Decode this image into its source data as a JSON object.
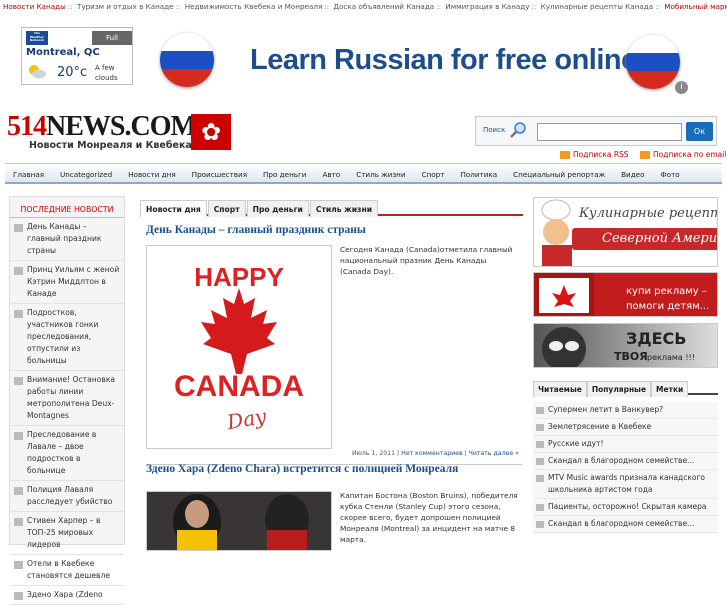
{
  "topnav": {
    "items": [
      "Новости Канады",
      "Туризм и отдых в Канаде",
      "Недвижимость Квебека и Монреаля",
      "Доска объявлений Канада",
      "Иммиграция в Канаду",
      "Кулинарные рецепты Канада",
      "Мобильный маркетинг"
    ],
    "separator": "::"
  },
  "weather": {
    "logo": "The Weather Network",
    "full_forecast": "Full Forecast",
    "city": "Montreal, QC",
    "temp": "20°c",
    "condition": "A few clouds"
  },
  "banner": {
    "text": "Learn Russian for free online!"
  },
  "logo": {
    "main": "514NEWS.COM",
    "tagline": "Новости Монреаля и Квебека"
  },
  "search": {
    "label": "Поиск",
    "placeholder": "",
    "button": "Ок"
  },
  "subscriptions": {
    "rss": "Подписка RSS",
    "email": "Подписка по email"
  },
  "mainnav": [
    "Главная",
    "Uncategorized",
    "Новости дня",
    "Происшествия",
    "Про деньги",
    "Авто",
    "Стиль жизни",
    "Спорт",
    "Политика",
    "Специальный репортаж",
    "Видео",
    "Фото"
  ],
  "left": {
    "title": "ПОСЛЕДНИЕ НОВОСТИ",
    "items": [
      "День Канады – главный праздник страны",
      "Принц Уильям с женой Кэтрин Миддлтон в Канаде",
      "Подростков, участников гонки преследования, отпустили из больницы",
      "Внимание! Остановка работы линии метрополитена Deux-Montagnes",
      "Преследование в Лавале – двое подростков в больнице",
      "Полиция Лаваля расследует убийство",
      "Стивен Харпер – в ТОП-25 мировых лидеров",
      "Отели в Квебеке становятся дешевле",
      "Здено Хара (Zdeno"
    ]
  },
  "center": {
    "tabs": [
      "Новости дня",
      "Спорт",
      "Про деньги",
      "Стиль жизни"
    ],
    "article1": {
      "title": "День Канады – главный праздник страны",
      "text": "Сегодня Канада (Canada)отметила главный национальный празник День Канады (Canada Day).",
      "image_text": {
        "happy": "HAPPY",
        "canada": "CANADA",
        "day": "Day"
      },
      "date": "Июль 1, 2011",
      "comments": "Нет комментариев",
      "more": "Читать далее »"
    },
    "article2": {
      "title": "Здено Хара (Zdeno Chara) встретится с полицией Монреаля",
      "text": "Капитан Бостона (Boston Bruins), победителя кубка Стенли (Stanley Cup) этого сезона, скорее всего, будет допрошен полицией Монреаля (Montreal) за инцидент на матче 8 марта."
    }
  },
  "right": {
    "ad1": {
      "line1": "Кулинарные рецепты",
      "line2": "Северной Америки"
    },
    "ad2": {
      "line1": "купи рекламу –",
      "line2": "помоги детям..."
    },
    "ad3": {
      "line1": "ЗДЕСЬ",
      "line2": "ТВОЯ",
      "line3": "реклама !!!"
    },
    "tabs": [
      "Читаемые",
      "Популярные",
      "Метки"
    ],
    "items": [
      "Супермен летит в Ванкувер?",
      "Землетрясение в Квебеке",
      "Русские идут!",
      "Скандал в благородном семействе...",
      "MTV Music awards признала канадского школьника артистом года",
      "Пациенты, осторожно! Скрытая камера",
      "Скандал в благородном семействе..."
    ]
  },
  "colors": {
    "accent_red": "#c00000",
    "link_blue": "#1a4d8f",
    "nav_border": "#8aaacc"
  }
}
